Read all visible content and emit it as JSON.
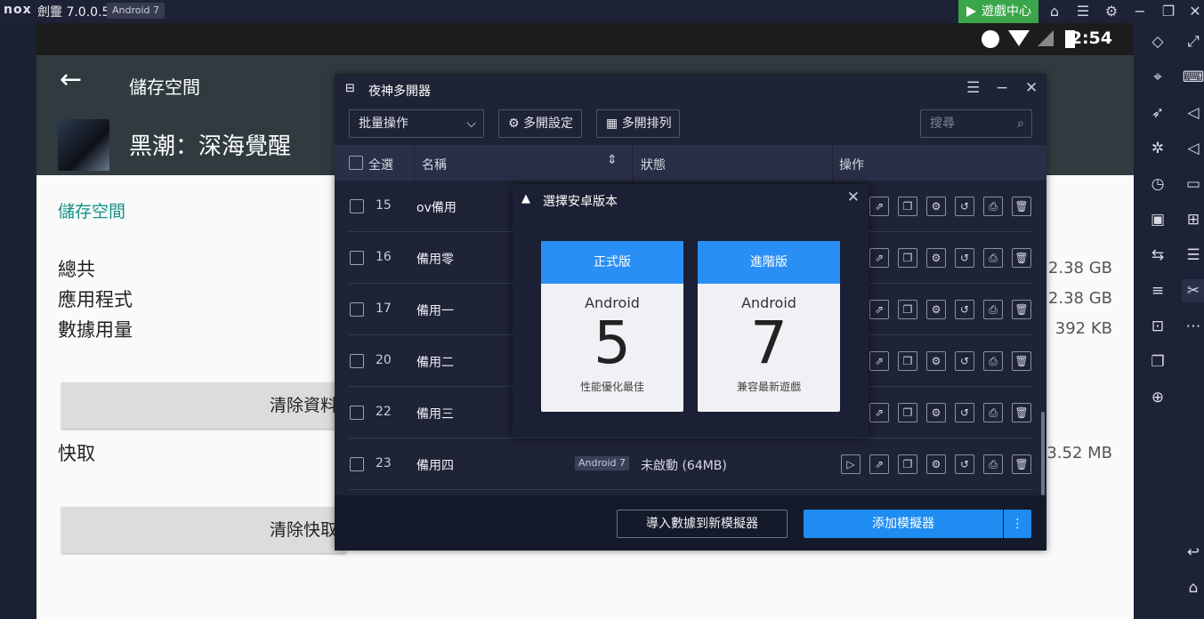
{
  "titlebar": {
    "logo": "nox",
    "app_name": "劍靈 7.0.0.5",
    "android_badge": "Android 7",
    "game_center": "遊戲中心",
    "icons": [
      "home-icon",
      "menu-icon",
      "gear-icon",
      "minimize-icon",
      "restore-icon",
      "close-icon"
    ]
  },
  "android": {
    "clock": "2:54",
    "appbar_title": "儲存空間",
    "game_title": "黑潮：深海覺醒",
    "storage_heading": "儲存空間",
    "rows": [
      {
        "label": "總共",
        "value": "2.38 GB"
      },
      {
        "label": "應用程式",
        "value": "2.38 GB"
      },
      {
        "label": "數據用量",
        "value": "392 KB"
      }
    ],
    "clear_data_button": "清除資料",
    "cache_label": "快取",
    "cache_value": "3.52 MB",
    "clear_cache_button": "清除快取"
  },
  "manager": {
    "title": "夜神多開器",
    "batch_select": "批量操作",
    "multi_settings": "多開設定",
    "multi_arrange": "多開排列",
    "search_placeholder": "搜尋",
    "col_select_all": "全選",
    "col_name": "名稱",
    "col_status": "狀態",
    "col_actions": "操作",
    "instances": [
      {
        "num": "15",
        "name": "ov備用"
      },
      {
        "num": "16",
        "name": "備用零"
      },
      {
        "num": "17",
        "name": "備用一"
      },
      {
        "num": "20",
        "name": "備用二"
      },
      {
        "num": "22",
        "name": "備用三"
      },
      {
        "num": "23",
        "name": "備用四",
        "version": "Android 7",
        "status": "未啟動 (64MB)"
      }
    ],
    "import_button": "導入數據到新模擬器",
    "add_button": "添加模擬器",
    "add_more": "⋮"
  },
  "dialog": {
    "title": "選擇安卓版本",
    "cards": [
      {
        "head": "正式版",
        "os": "Android",
        "num": "5",
        "desc": "性能優化最佳"
      },
      {
        "head": "進階版",
        "os": "Android",
        "num": "7",
        "desc": "兼容最新遊戲"
      }
    ]
  }
}
